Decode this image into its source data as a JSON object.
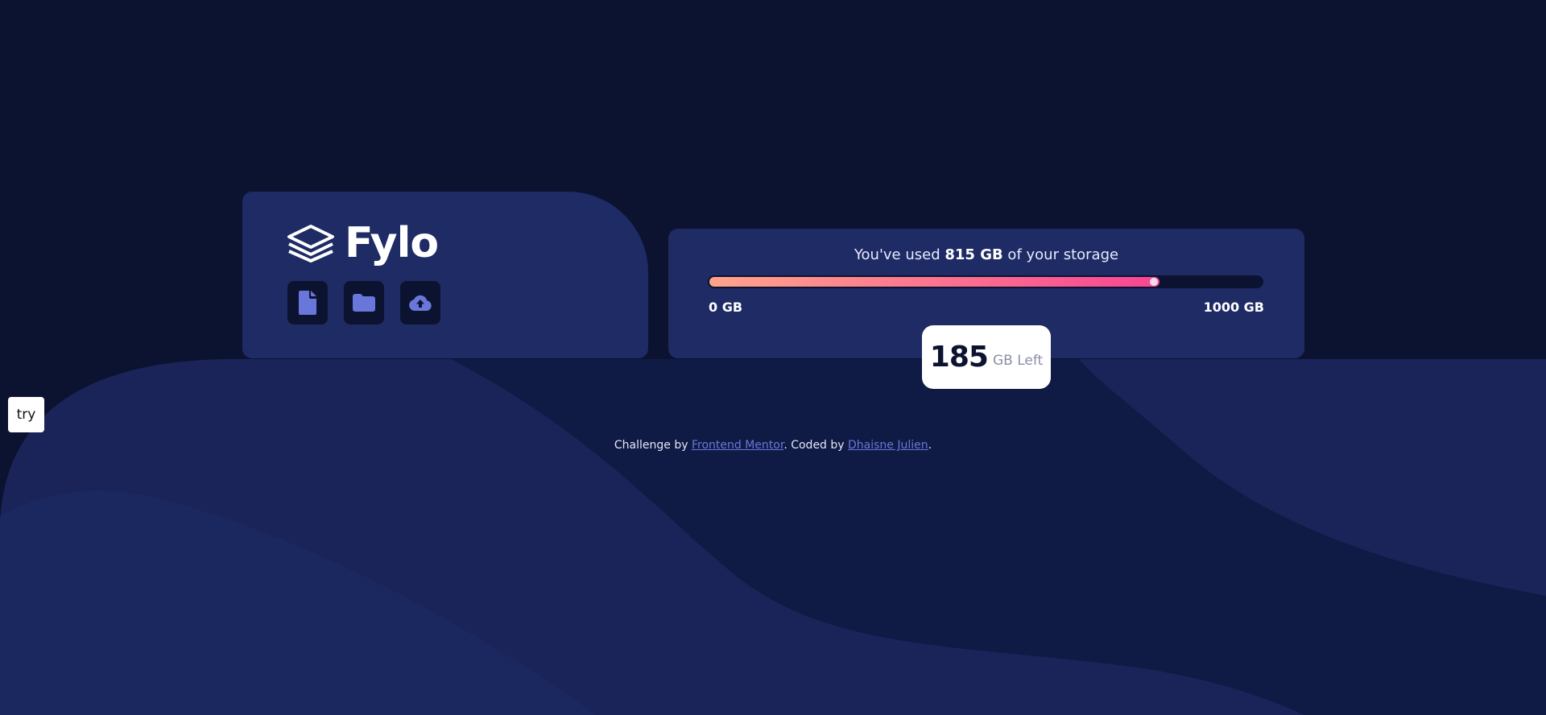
{
  "brand": {
    "name": "Fylo",
    "logo_icon": "stacked-layers-icon"
  },
  "toolbar": {
    "buttons": [
      {
        "name": "document",
        "icon": "document-icon"
      },
      {
        "name": "folder",
        "icon": "folder-icon"
      },
      {
        "name": "upload",
        "icon": "cloud-upload-icon"
      }
    ]
  },
  "storage": {
    "prefix": "You've used ",
    "used": "815 GB",
    "suffix": " of your storage",
    "min_label": "0 GB",
    "max_label": "1000 GB",
    "used_fraction": 0.815,
    "left_value": "185",
    "left_unit": "GB Left"
  },
  "try_button": {
    "label": "try"
  },
  "footer": {
    "prefix": "Challenge by ",
    "link1": "Frontend Mentor",
    "middle": ". Coded by ",
    "link2": "Dhaisne Julien",
    "suffix": "."
  },
  "colors": {
    "background": "#0c1330",
    "card": "#1e2b64",
    "accent_icon": "#6877d9",
    "gradient_start": "#ffa38b",
    "gradient_end": "#f74594"
  }
}
